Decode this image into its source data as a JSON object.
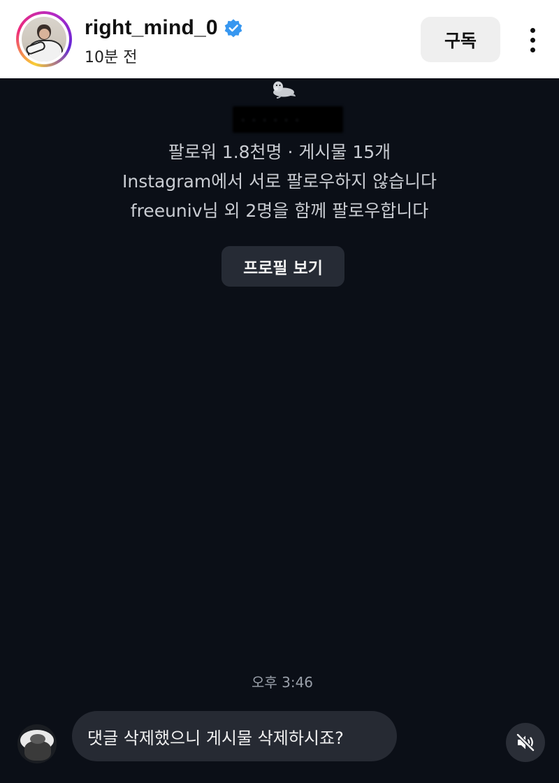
{
  "header": {
    "username": "right_mind_0",
    "timestamp": "10분 전",
    "subscribe_label": "구독"
  },
  "profile_card": {
    "followers_line": "팔로워 1.8천명 · 게시물 15개",
    "mutual_line": "Instagram에서 서로 팔로우하지 않습니다",
    "followed_by_line": "freeuniv님 외 2명을 함께 팔로우합니다",
    "view_profile_label": "프로필 보기"
  },
  "conversation": {
    "time_label": "오후 3:46",
    "message_text": "댓글 삭제했으니 게시물 삭제하시죠?"
  },
  "colors": {
    "background": "#0b0f17",
    "bubble": "#262a33",
    "verified_badge": "#3797f0",
    "button_dark": "#262b35",
    "button_light": "#efefef"
  },
  "icons": {
    "verified": "verified-badge-icon",
    "more": "more-vertical-icon",
    "seal": "seal-emoji-icon",
    "mute": "speaker-muted-icon"
  }
}
